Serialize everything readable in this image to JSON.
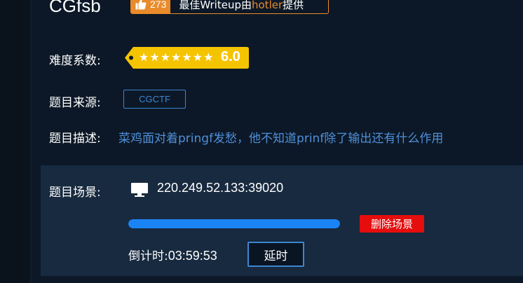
{
  "challenge": {
    "title": "CGfsb",
    "likes": "273",
    "writeup_prefix": "最佳Writeup由",
    "writeup_author": "hotler",
    "writeup_suffix": "提供"
  },
  "difficulty": {
    "label": "难度系数:",
    "stars_display": "★★★★★★★",
    "star_count": 7,
    "value": "6.0"
  },
  "source": {
    "label": "题目来源:",
    "tag": "CGCTF"
  },
  "description": {
    "label": "题目描述:",
    "text": "菜鸡面对着pringf发愁，他不知道prinf除了输出还有什么作用"
  },
  "scene": {
    "label": "题目场景:",
    "address": "220.249.52.133:39020",
    "progress_fraction": 1.0,
    "delete_label": "删除场景",
    "countdown_label": "倒计时:",
    "countdown_time": "03:59:53",
    "extend_label": "延时"
  },
  "colors": {
    "accent_orange": "#e98b2a",
    "rating_yellow": "#f5c400",
    "link_blue": "#3d86d1",
    "progress_blue": "#1a84f7",
    "danger_red": "#e50d0d",
    "background": "#0b1624"
  },
  "icons": {
    "like": "thumbs-up-icon",
    "monitor": "monitor-icon"
  }
}
